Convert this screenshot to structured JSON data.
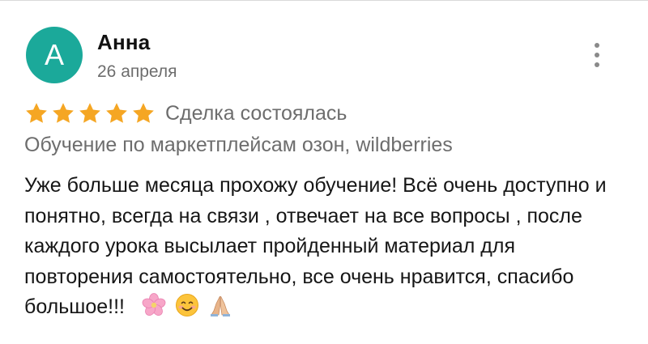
{
  "review": {
    "author_initial": "А",
    "author_name": "Анна",
    "date": "26 апреля",
    "rating": 5,
    "rating_max": 5,
    "deal_status": "Сделка состоялась",
    "product": "Обучение по маркетплейсам озон, wildberries",
    "text": "Уже больше месяца прохожу обучение! Всё очень доступно и понятно, всегда на связи , отвечает на все вопросы , после каждого урока высылает пройденный материал для повторения самостоятельно, все очень нравится, спасибо большое!!!",
    "emojis": [
      "cherry-blossom-icon",
      "smiling-face-icon",
      "folded-hands-icon"
    ]
  },
  "colors": {
    "avatar_bg": "#1ba99a",
    "star": "#f5a623",
    "muted_text": "#6d6d6d",
    "menu_dots": "#8a8a8a"
  },
  "icons": {
    "menu": "more-vertical-icon",
    "star": "star-icon"
  }
}
